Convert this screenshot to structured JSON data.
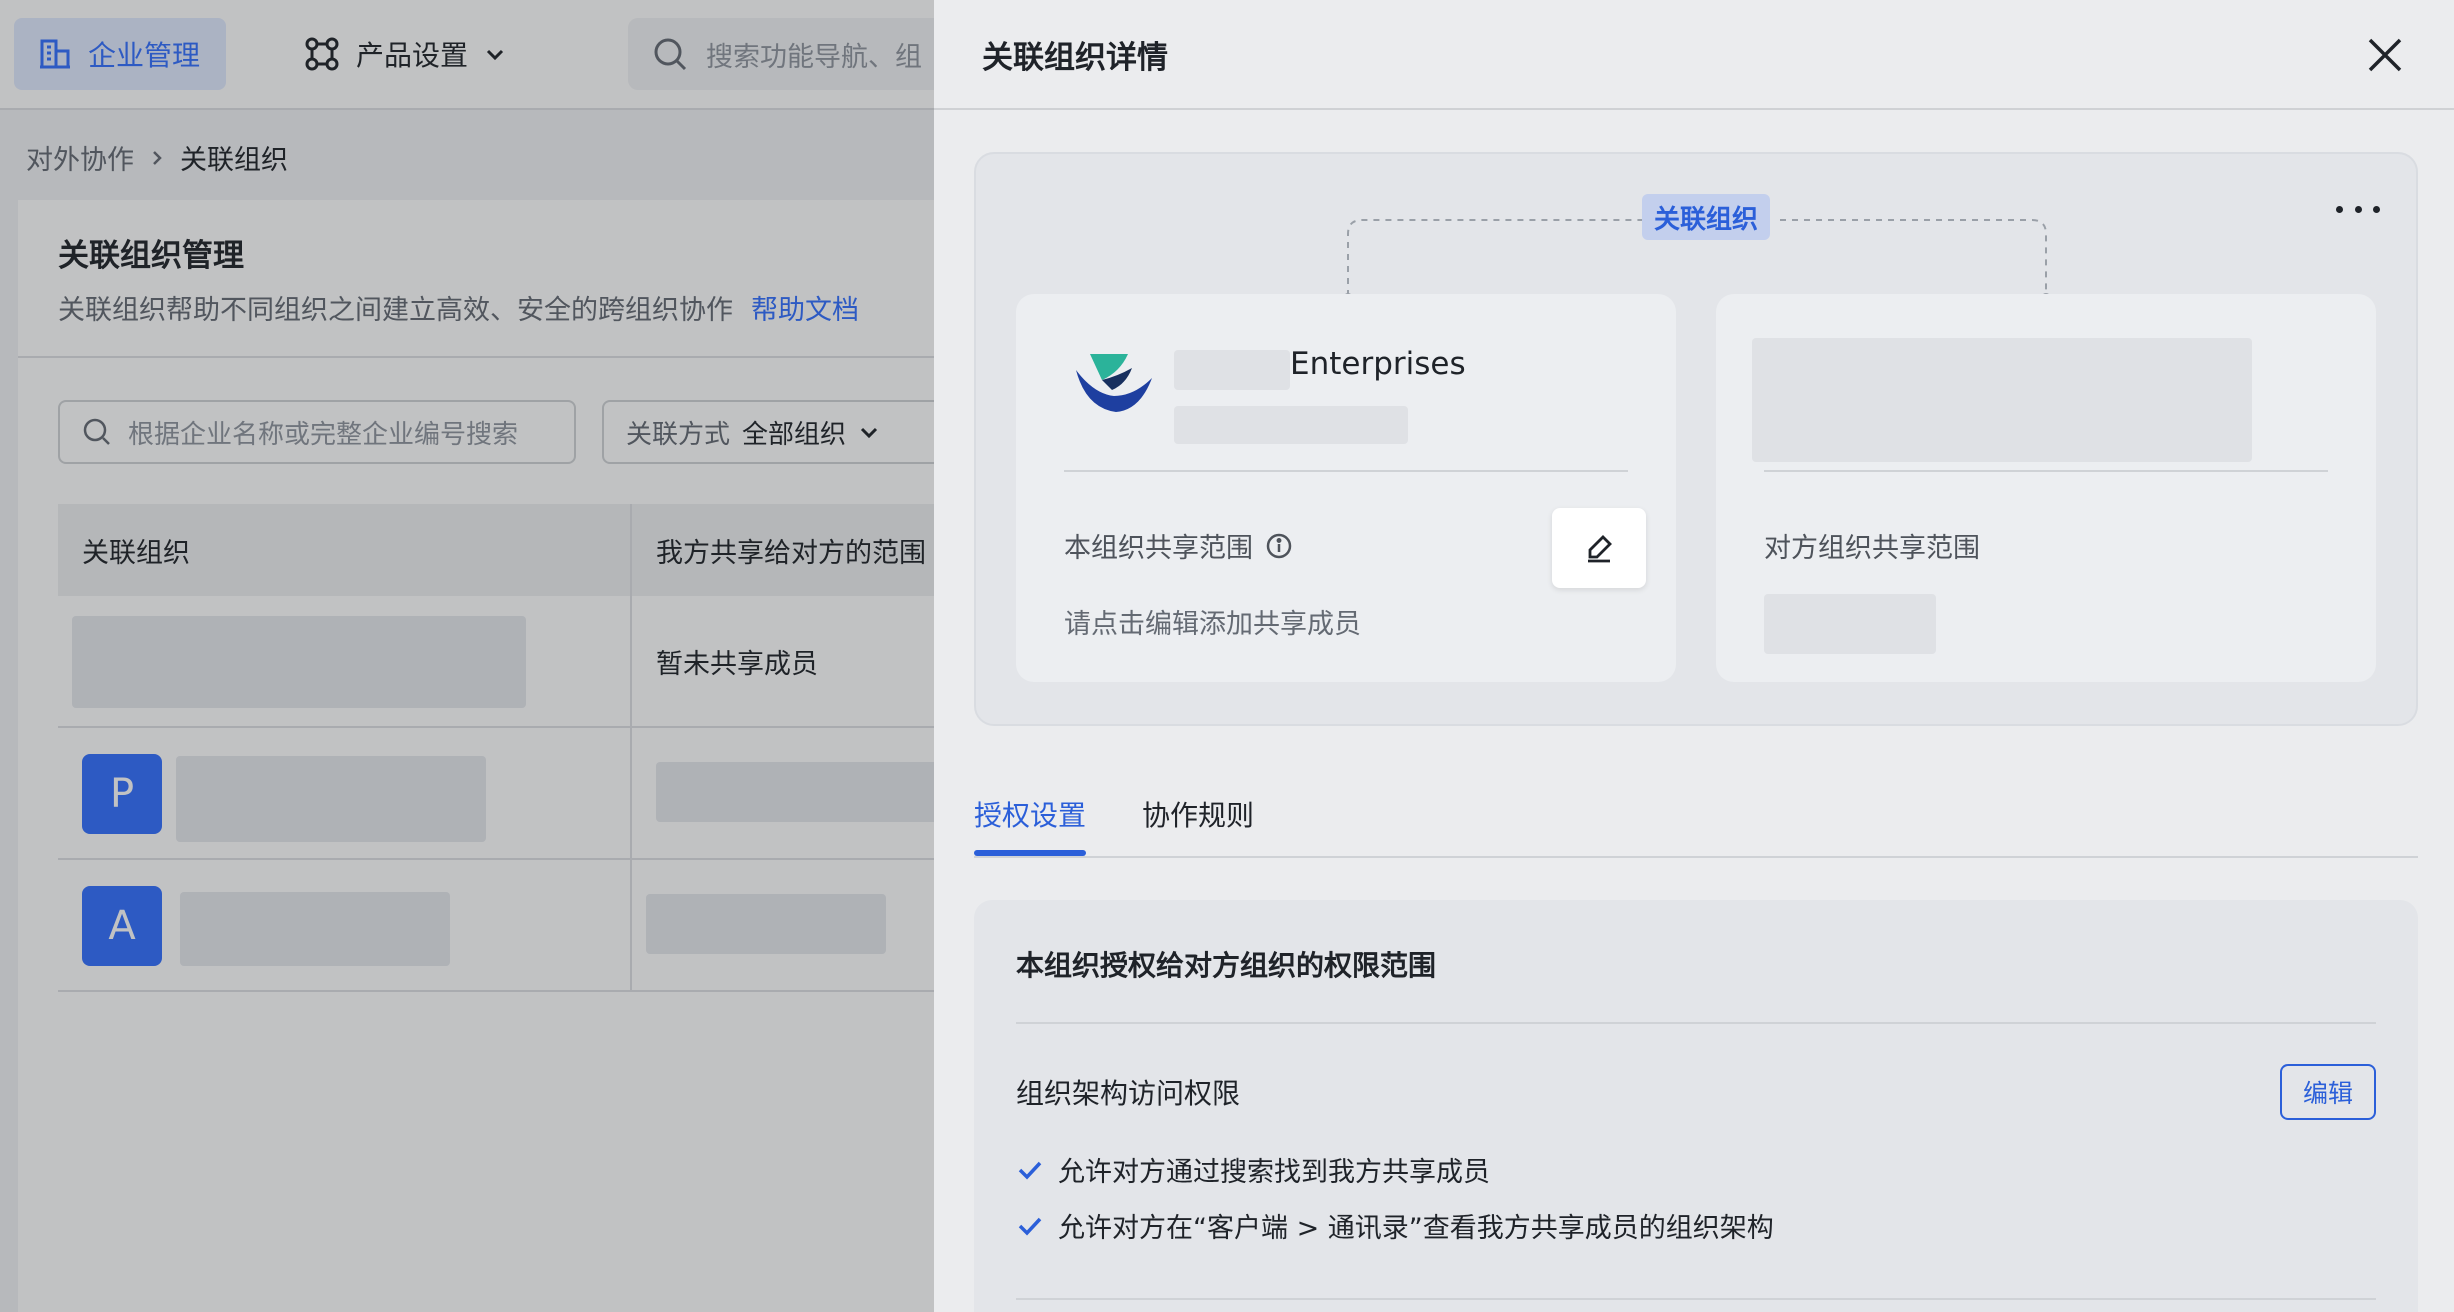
{
  "topbar": {
    "enterprise_label": "企业管理",
    "product_label": "产品设置",
    "search_placeholder": "搜索功能导航、组"
  },
  "breadcrumb": {
    "parent": "对外协作",
    "current": "关联组织"
  },
  "page": {
    "title": "关联组织管理",
    "description": "关联组织帮助不同组织之间建立高效、安全的跨组织协作",
    "help_link": "帮助文档"
  },
  "filters": {
    "search_placeholder": "根据企业名称或完整企业编号搜索",
    "mode_label": "关联方式",
    "mode_value": "全部组织"
  },
  "table": {
    "columns": [
      "关联组织",
      "我方共享给对方的范围"
    ],
    "rows": [
      {
        "avatar": "",
        "share": "暂未共享成员"
      },
      {
        "avatar": "P",
        "share": ""
      },
      {
        "avatar": "A",
        "share": ""
      }
    ]
  },
  "drawer": {
    "title": "关联组织详情",
    "relation_tag": "关联组织",
    "own_card": {
      "name": "Enterprises",
      "share_label": "本组织共享范围",
      "share_hint": "请点击编辑添加共享成员"
    },
    "peer_card": {
      "share_label": "对方组织共享范围"
    },
    "tabs": [
      {
        "label": "授权设置",
        "active": true
      },
      {
        "label": "协作规则",
        "active": false
      }
    ],
    "permissions": {
      "title": "本组织授权给对方组织的权限范围",
      "section_label": "组织架构访问权限",
      "edit_label": "编辑",
      "items": [
        "允许对方通过搜索找到我方共享成员",
        "允许对方在“客户端 > 通讯录”查看我方共享成员的组织架构"
      ]
    }
  },
  "colors": {
    "accent": "#3370ff",
    "accent_dim": "#2b5fd9",
    "logo_teal": "#2bb39a",
    "logo_navy": "#1e3fa0"
  }
}
